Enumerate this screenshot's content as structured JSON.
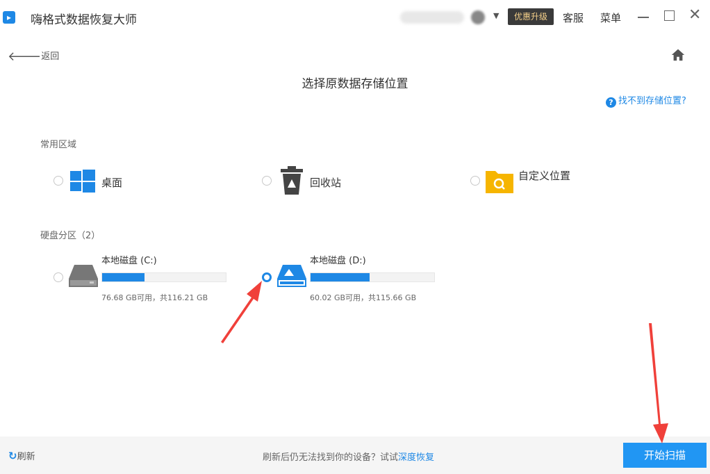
{
  "window": {
    "title": "嗨格式数据恢复大师",
    "upgrade_label": "优惠升级",
    "service_label": "客服",
    "menu_label": "菜单"
  },
  "nav": {
    "back_label": "返回"
  },
  "page": {
    "title": "选择原数据存储位置",
    "help_link": "找不到存储位置?"
  },
  "common_area": {
    "label": "常用区域",
    "items": [
      {
        "label": "桌面",
        "icon": "windows-icon"
      },
      {
        "label": "回收站",
        "icon": "recycle-bin-icon"
      },
      {
        "label": "自定义位置",
        "icon": "folder-search-icon"
      }
    ]
  },
  "partitions": {
    "label": "硬盘分区（2）",
    "drives": [
      {
        "name": "本地磁盘 (C:)",
        "info": "76.68 GB可用，共116.21 GB",
        "used_fraction": 0.34,
        "selected": false
      },
      {
        "name": "本地磁盘 (D:)",
        "info": "60.02 GB可用，共115.66 GB",
        "used_fraction": 0.48,
        "selected": true
      }
    ]
  },
  "footer": {
    "refresh_label": "刷新",
    "hint": "刷新后仍无法找到你的设备？试试",
    "deep_recovery_link": "深度恢复",
    "scan_button": "开始扫描"
  },
  "colors": {
    "accent": "#1e88e5",
    "annotation": "#f0403a"
  }
}
